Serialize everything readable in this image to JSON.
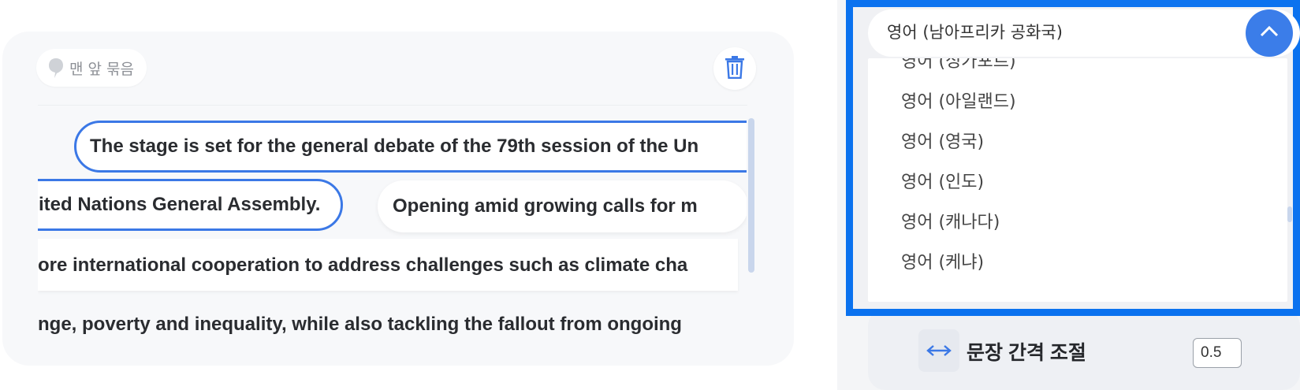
{
  "editor": {
    "chip_label": "맨 앞 묶음",
    "line1_sentence": "The stage is set for the general debate of the 79th session of the Un",
    "line2_sentence_a": "ited Nations General Assembly.",
    "line2_sentence_b": "Opening amid growing calls for m",
    "line3_text": "ore international cooperation to address challenges such as climate cha",
    "line4_text": "nge, poverty and inequality, while also tackling the fallout from ongoing"
  },
  "language_select": {
    "selected_value": "영어 (남아프리카 공화국)",
    "options": [
      "영어 (싱가포르)",
      "영어 (아일랜드)",
      "영어 (영국)",
      "영어 (인도)",
      "영어 (캐나다)",
      "영어 (케냐)"
    ]
  },
  "sentence_spacing": {
    "label": "문장 간격 조절",
    "value": "0.5"
  },
  "colors": {
    "accent": "#3b78e6",
    "highlight_frame": "#0b72ef"
  },
  "icons": {
    "chip": "speech-bubble-icon",
    "delete": "trash-icon",
    "toggle": "chevron-up-icon",
    "spacing": "horizontal-arrows-icon"
  }
}
